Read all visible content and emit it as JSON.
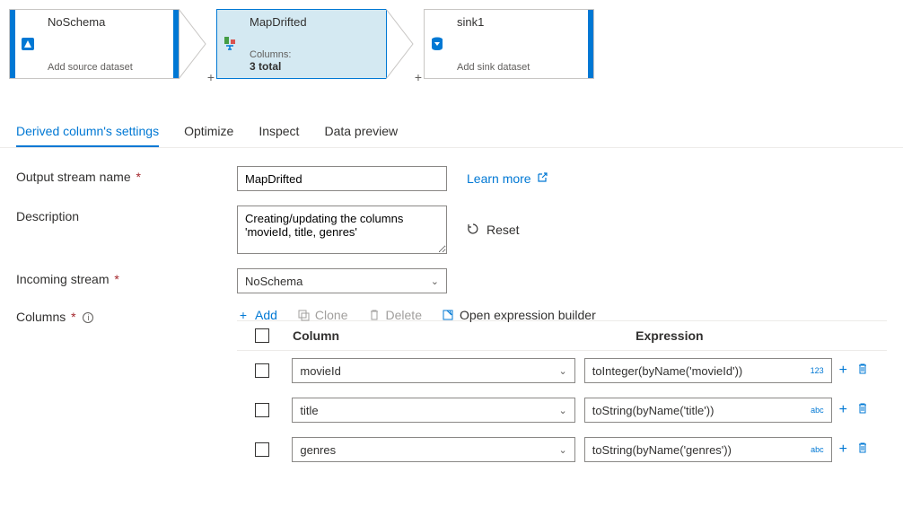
{
  "pipeline": {
    "nodes": [
      {
        "title": "NoSchema",
        "subtitle": "Add source dataset"
      },
      {
        "title": "MapDrifted",
        "sub_label": "Columns:",
        "sub_value": "3 total"
      },
      {
        "title": "sink1",
        "subtitle": "Add sink dataset"
      }
    ]
  },
  "tabs": {
    "settings": "Derived column's settings",
    "optimize": "Optimize",
    "inspect": "Inspect",
    "preview": "Data preview"
  },
  "form": {
    "output_stream_label": "Output stream name",
    "output_stream_value": "MapDrifted",
    "description_label": "Description",
    "description_value": "Creating/updating the columns 'movieId, title, genres'",
    "incoming_label": "Incoming stream",
    "incoming_value": "NoSchema",
    "columns_label": "Columns",
    "learn_more": "Learn more",
    "reset": "Reset"
  },
  "toolbar": {
    "add": "Add",
    "clone": "Clone",
    "delete": "Delete",
    "expr_builder": "Open expression builder"
  },
  "table": {
    "header_column": "Column",
    "header_expression": "Expression",
    "rows": [
      {
        "column": "movieId",
        "expression": "toInteger(byName('movieId'))",
        "type": "123"
      },
      {
        "column": "title",
        "expression": "toString(byName('title'))",
        "type": "abc"
      },
      {
        "column": "genres",
        "expression": "toString(byName('genres'))",
        "type": "abc"
      }
    ]
  }
}
